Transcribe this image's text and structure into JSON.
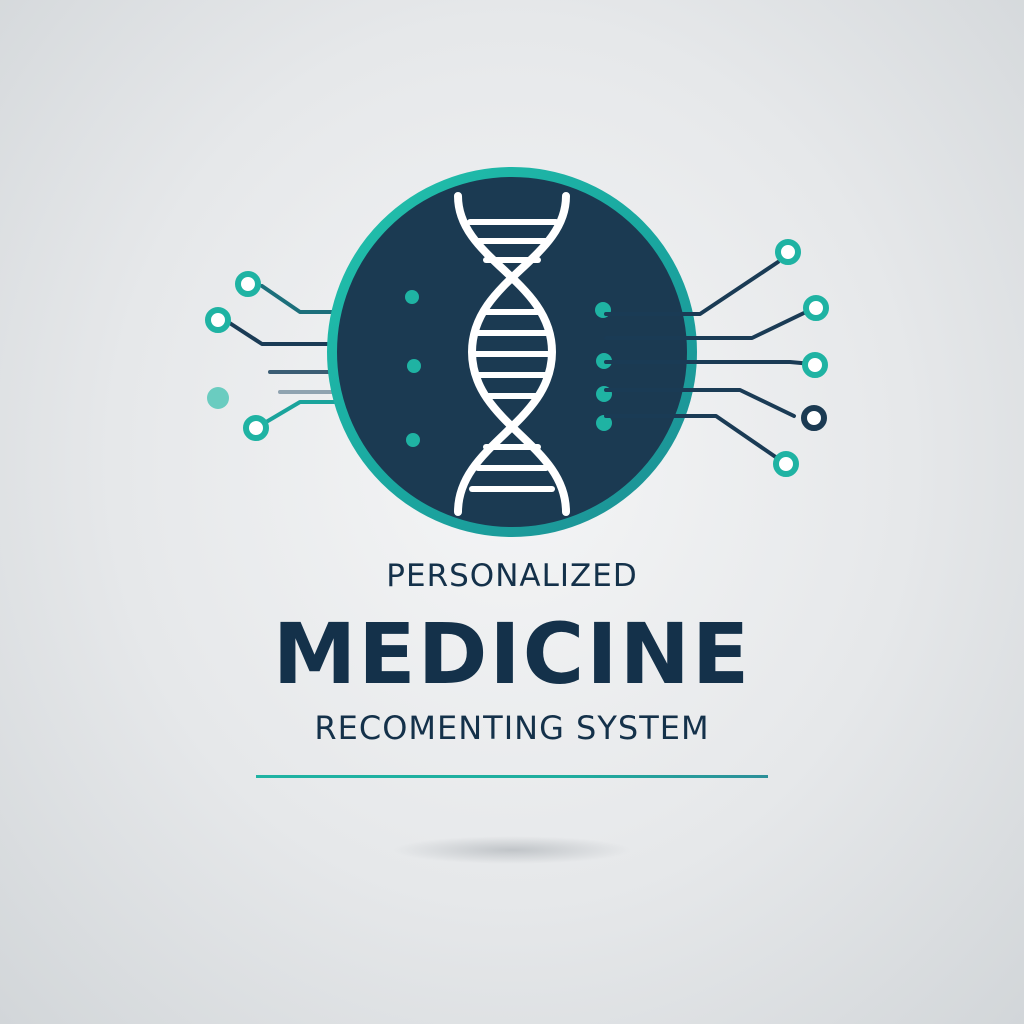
{
  "logo": {
    "line1": "PERSONALIZED",
    "line2": "MEDICINE",
    "line3": "RECOMENTING SYSTEM"
  },
  "colors": {
    "teal": "#1fb3a3",
    "navy": "#14314a",
    "disc": "#1b3a52",
    "background": "#e6e8ea"
  },
  "icons": {
    "emblem": "dna-helix-circuit-icon"
  }
}
